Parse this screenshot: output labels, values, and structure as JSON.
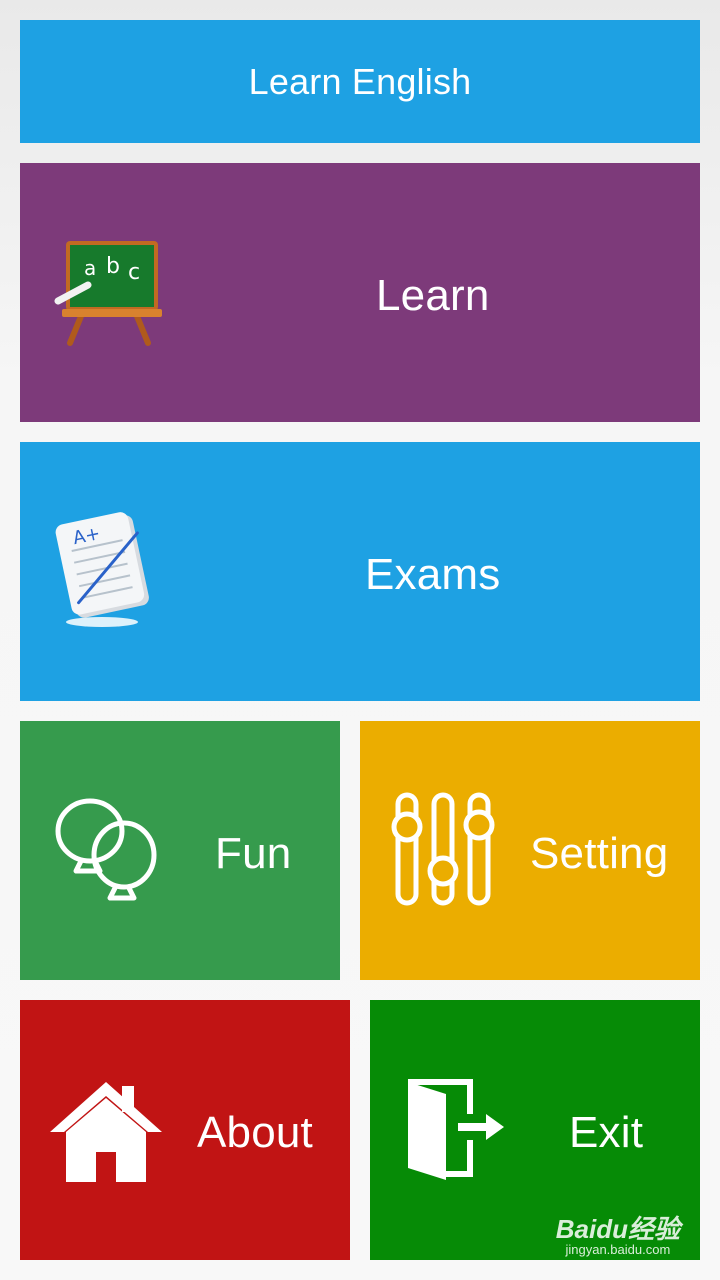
{
  "header": {
    "title": "Learn English",
    "color": "#1ea1e3"
  },
  "tiles": {
    "learn": {
      "label": "Learn",
      "color": "#7d3a7a",
      "icon": "chalkboard-icon"
    },
    "exams": {
      "label": "Exams",
      "color": "#1ea1e3",
      "icon": "exam-paper-icon"
    },
    "fun": {
      "label": "Fun",
      "color": "#369b4d",
      "icon": "balloons-icon"
    },
    "setting": {
      "label": "Setting",
      "color": "#ebad00",
      "icon": "sliders-icon"
    },
    "about": {
      "label": "About",
      "color": "#c11414",
      "icon": "home-icon"
    },
    "exit": {
      "label": "Exit",
      "color": "#068b06",
      "icon": "exit-door-icon"
    }
  },
  "watermark": {
    "brand": "Baidu经验",
    "site": "jingyan.baidu.com"
  }
}
